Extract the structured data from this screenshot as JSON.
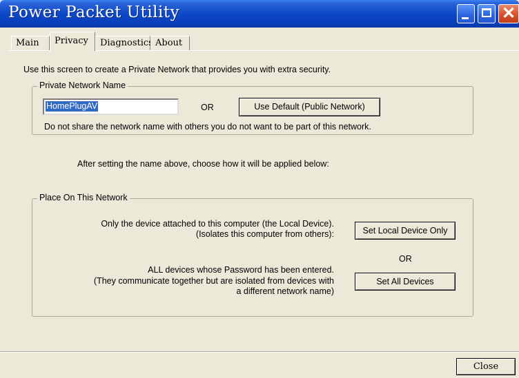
{
  "window": {
    "title": "Power Packet Utility",
    "colors": {
      "titlebar": "#0a3eb8",
      "close_button": "#d8502a",
      "dialog_bg": "#ece9d8",
      "selection": "#316ac5"
    }
  },
  "tabs": [
    {
      "label": "Main"
    },
    {
      "label": "Privacy",
      "active": true
    },
    {
      "label": "Diagnostics"
    },
    {
      "label": "About"
    }
  ],
  "privacy": {
    "intro": "Use this screen to create a Private Network that provides you with extra security.",
    "network_name_group": {
      "legend": "Private Network Name",
      "input_value": "HomePlugAV",
      "or_label": "OR",
      "use_default_label": "Use Default (Public Network)",
      "warning": "Do not share the network name with others you do not want to be part of this network."
    },
    "after_text": "After setting the name above, choose how it will be applied below:",
    "place_group": {
      "legend": "Place On This Network",
      "local_line1": "Only the device attached to this computer (the Local Device).",
      "local_line2": "(Isolates this computer from others):",
      "set_local_label": "Set Local Device Only",
      "or_label": "OR",
      "all_line1": "ALL devices whose Password has been entered.",
      "all_line2": "(They communicate together but are isolated from devices with",
      "all_line3": "a different network name)",
      "set_all_label": "Set All Devices"
    }
  },
  "footer": {
    "close_label": "Close"
  },
  "icons": {
    "minimize": "minimize-icon",
    "maximize": "maximize-icon",
    "close": "close-icon"
  }
}
